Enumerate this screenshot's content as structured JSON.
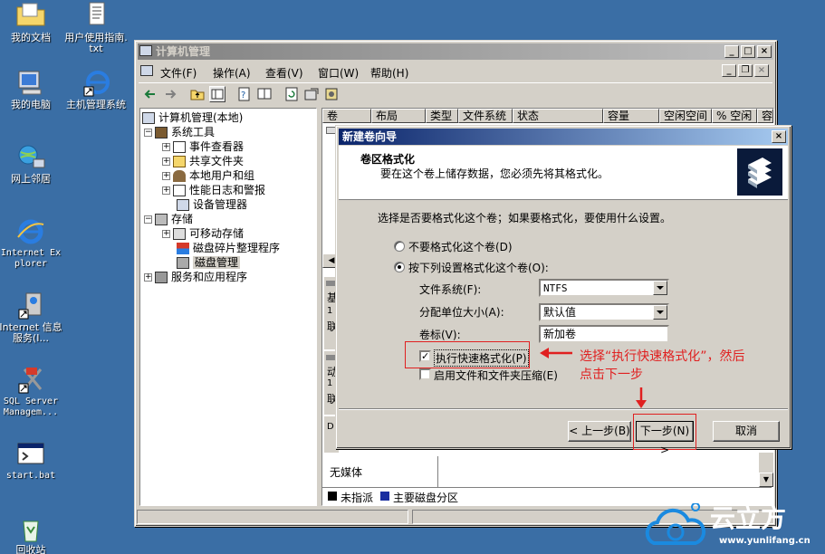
{
  "desktop": {
    "icons": [
      {
        "label": "我的文档"
      },
      {
        "label": "用户使用指南.txt"
      },
      {
        "label": "我的电脑"
      },
      {
        "label": "主机管理系统"
      },
      {
        "label": "网上邻居"
      },
      {
        "label": "Internet Explorer"
      },
      {
        "label": "Internet 信息服务(I..."
      },
      {
        "label": "SQL Server Managem..."
      },
      {
        "label": "start.bat"
      },
      {
        "label": "回收站"
      }
    ]
  },
  "mmc": {
    "title": "计算机管理",
    "menu": [
      "文件(F)",
      "操作(A)",
      "查看(V)",
      "窗口(W)",
      "帮助(H)"
    ],
    "tree": [
      {
        "label": "计算机管理(本地)"
      },
      {
        "label": "系统工具"
      },
      {
        "label": "事件查看器"
      },
      {
        "label": "共享文件夹"
      },
      {
        "label": "本地用户和组"
      },
      {
        "label": "性能日志和警报"
      },
      {
        "label": "设备管理器"
      },
      {
        "label": "存储"
      },
      {
        "label": "可移动存储"
      },
      {
        "label": "磁盘碎片整理程序"
      },
      {
        "label": "磁盘管理"
      },
      {
        "label": "服务和应用程序"
      }
    ],
    "columns": [
      "卷",
      "布局",
      "类型",
      "文件系统",
      "状态",
      "容量",
      "空闲空间",
      "% 空闲",
      "容"
    ],
    "disk_labels": {
      "d1": [
        "基",
        "1",
        "联"
      ],
      "d2": [
        "动",
        "1",
        "联"
      ],
      "d3": "D"
    },
    "no_media": "无媒体",
    "legend": [
      "未指派",
      "主要磁盘分区"
    ]
  },
  "wizard": {
    "title": "新建卷向导",
    "header_title": "卷区格式化",
    "header_desc": "要在这个卷上储存数据，您必须先将其格式化。",
    "prompt": "选择是否要格式化这个卷；如果要格式化，要使用什么设置。",
    "opt_no_format": "不要格式化这个卷(D)",
    "opt_format": "按下列设置格式化这个卷(O):",
    "fs_label": "文件系统(F):",
    "fs_value": "NTFS",
    "alloc_label": "分配单位大小(A):",
    "alloc_value": "默认值",
    "vol_label": "卷标(V):",
    "vol_value": "新加卷",
    "quick_format": "执行快速格式化(P)",
    "compress": "启用文件和文件夹压缩(E)",
    "btn_back": "< 上一步(B)",
    "btn_next": "下一步(N) >",
    "btn_cancel": "取消"
  },
  "annotation": {
    "line1": "选择“执行快速格式化”，然后",
    "line2": "点击下一步"
  },
  "watermark": {
    "brand": "云立方",
    "url": "www.yunlifang.cn"
  },
  "colors": {
    "desktop": "#3a6ea5",
    "title_active": "#0a246a",
    "annotation": "#e02020"
  }
}
